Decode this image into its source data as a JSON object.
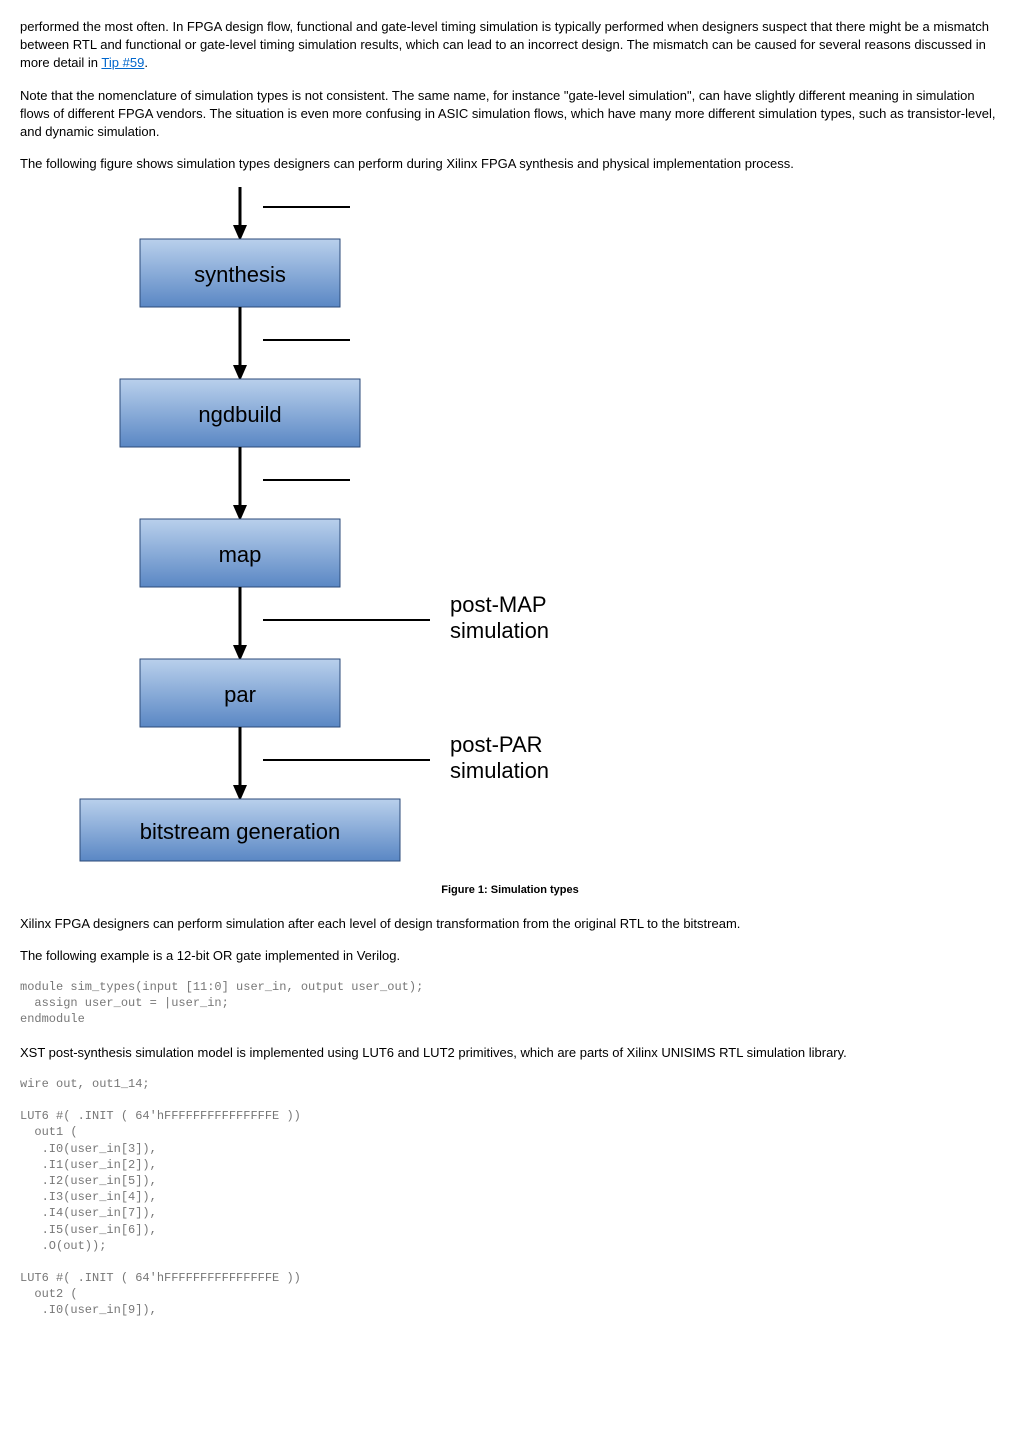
{
  "para1_a": "performed the most often. In FPGA design flow, functional and gate-level timing simulation is typically performed when designers suspect that there might be a mismatch between RTL and functional or gate-level timing simulation results, which can lead to an incorrect design. The mismatch can be caused for several reasons discussed in more detail in ",
  "para1_link": "Tip #59",
  "para1_b": ".",
  "para2": "Note that the nomenclature of simulation types is not consistent. The same name, for instance \"gate-level simulation\", can have slightly different meaning in simulation flows of different FPGA vendors. The situation is even more confusing in ASIC simulation flows, which have many more different simulation types, such as transistor-level, and dynamic simulation.",
  "para3": "The following figure shows simulation types designers can perform during Xilinx FPGA synthesis and physical implementation process.",
  "diagram": {
    "box1": "synthesis",
    "box2": "ngdbuild",
    "box3": "map",
    "box4": "par",
    "box5": "bitstream generation",
    "label1": "post-MAP\nsimulation",
    "label2": "post-PAR\nsimulation"
  },
  "figureCaption": "Figure 1: Simulation types",
  "para4": "Xilinx FPGA designers can perform simulation after each level of design transformation from the original RTL to the bitstream.",
  "para5": "The following example is a 12-bit OR gate implemented in Verilog.",
  "code1": "module sim_types(input [11:0] user_in, output user_out);\n  assign user_out = |user_in;\nendmodule",
  "para6": "XST post-synthesis simulation model is implemented using LUT6 and LUT2 primitives, which are parts of Xilinx UNISIMS RTL simulation library.",
  "code2": "wire out, out1_14;\n\nLUT6 #( .INIT ( 64'hFFFFFFFFFFFFFFFE ))\n  out1 (\n   .I0(user_in[3]),\n   .I1(user_in[2]),\n   .I2(user_in[5]),\n   .I3(user_in[4]),\n   .I4(user_in[7]),\n   .I5(user_in[6]),\n   .O(out));\n\nLUT6 #( .INIT ( 64'hFFFFFFFFFFFFFFFE ))\n  out2 (\n   .I0(user_in[9]),"
}
